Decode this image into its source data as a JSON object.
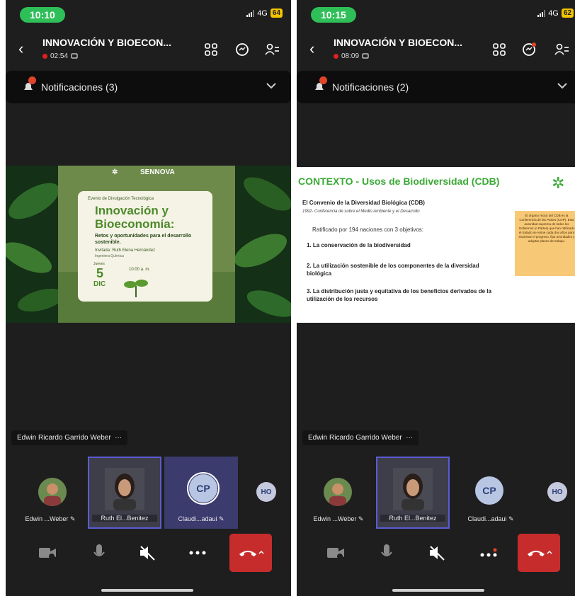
{
  "left": {
    "status": {
      "time": "10:10",
      "network": "4G",
      "battery": "64"
    },
    "meeting": {
      "title": "INNOVACIÓN Y BIOECON...",
      "timer": "02:54"
    },
    "notifications": {
      "label": "Notificaciones (3)"
    },
    "poster": {
      "brand": "SENNOVA",
      "event": "Evento de Divulgación Tecnológica",
      "title_line1": "Innovación y",
      "title_line2": "Bioeconomía:",
      "subtitle": "Retos y oportunidades para el desarrollo sostenible.",
      "speaker": "Invitada: Ruth Elena Hernández",
      "speaker_role": "Ingeniera Química",
      "day_label": "Jueves",
      "day": "5",
      "month": "DIC",
      "time": "10:00 a. m."
    },
    "active_speaker": "Edwin Ricardo Garrido Weber",
    "participants": [
      {
        "name": "Edwin ...Weber"
      },
      {
        "name": "Ruth El...Benitez"
      },
      {
        "name": "Claudi...adaui",
        "initials": "CP"
      },
      {
        "initials": "HO"
      }
    ]
  },
  "right": {
    "status": {
      "time": "10:15",
      "network": "4G",
      "battery": "62"
    },
    "meeting": {
      "title": "INNOVACIÓN Y BIOECON...",
      "timer": "08:09"
    },
    "notifications": {
      "label": "Notificaciones (2)"
    },
    "slide": {
      "heading": "CONTEXTO - Usos de Biodiversidad (CDB)",
      "subheading": "El Convenio de la Diversidad Biológica (CDB)",
      "note": "1992- Conferencia de sobre el Medio Ambiente y el Desarrollo",
      "intro": "Ratificado por 194 naciones con 3 objetivos:",
      "items": [
        "1. La conservación de la biodiversidad",
        "2. La utilización sostenible de los componentes de la diversidad biológica",
        "3. La distribución justa y equitativa de los beneficios derivados de la utilización de los recursos"
      ],
      "side_box": "El órgano rector del CDB es la Conferencia de las Partes (COP). Esta autoridad suprema de todos los Gobiernos (o Partes) que han ratificado el tratado se reúne cada dos años para examinar el progreso, fijar prioridades y adoptar planes de trabajo."
    },
    "active_speaker": "Edwin Ricardo Garrido Weber",
    "participants": [
      {
        "name": "Edwin ...Weber"
      },
      {
        "name": "Ruth El...Benitez"
      },
      {
        "name": "Claudi...adaui",
        "initials": "CP"
      },
      {
        "initials": "HO"
      }
    ]
  },
  "colors": {
    "accent_green": "#2fbf58",
    "end_call": "#c72c2c",
    "slide_green": "#3aaa35"
  }
}
